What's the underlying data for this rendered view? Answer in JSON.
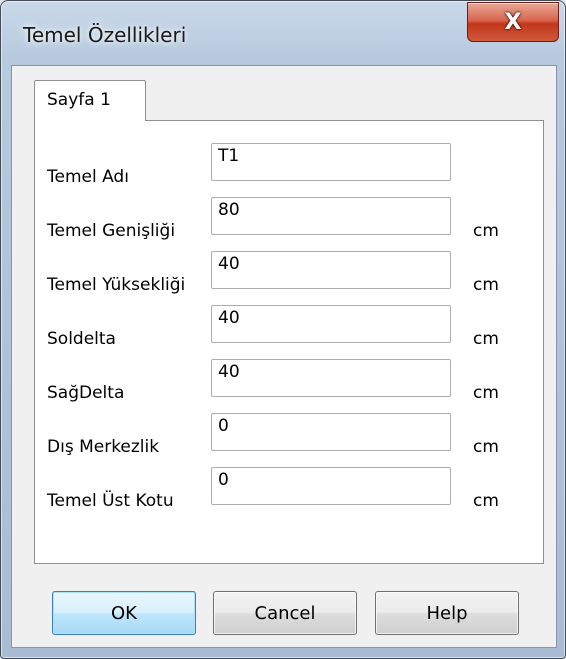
{
  "window": {
    "title": "Temel Özellikleri",
    "close_label": "X"
  },
  "tabs": [
    {
      "label": "Sayfa 1",
      "selected": true
    }
  ],
  "form": {
    "rows": [
      {
        "label": "Temel Adı",
        "value": "T1",
        "unit": ""
      },
      {
        "label": "Temel Genişliği",
        "value": "80",
        "unit": "cm"
      },
      {
        "label": "Temel Yüksekliği",
        "value": "40",
        "unit": "cm"
      },
      {
        "label": "Soldelta",
        "value": "40",
        "unit": "cm"
      },
      {
        "label": "SağDelta",
        "value": "40",
        "unit": "cm"
      },
      {
        "label": "Dış Merkezlik",
        "value": "0",
        "unit": "cm"
      },
      {
        "label": "Temel Üst Kotu",
        "value": "0",
        "unit": "cm"
      }
    ]
  },
  "buttons": {
    "ok": "OK",
    "cancel": "Cancel",
    "help": "Help"
  },
  "colors": {
    "close_button": "#c3361b",
    "default_button_border": "#3c7fb1"
  }
}
